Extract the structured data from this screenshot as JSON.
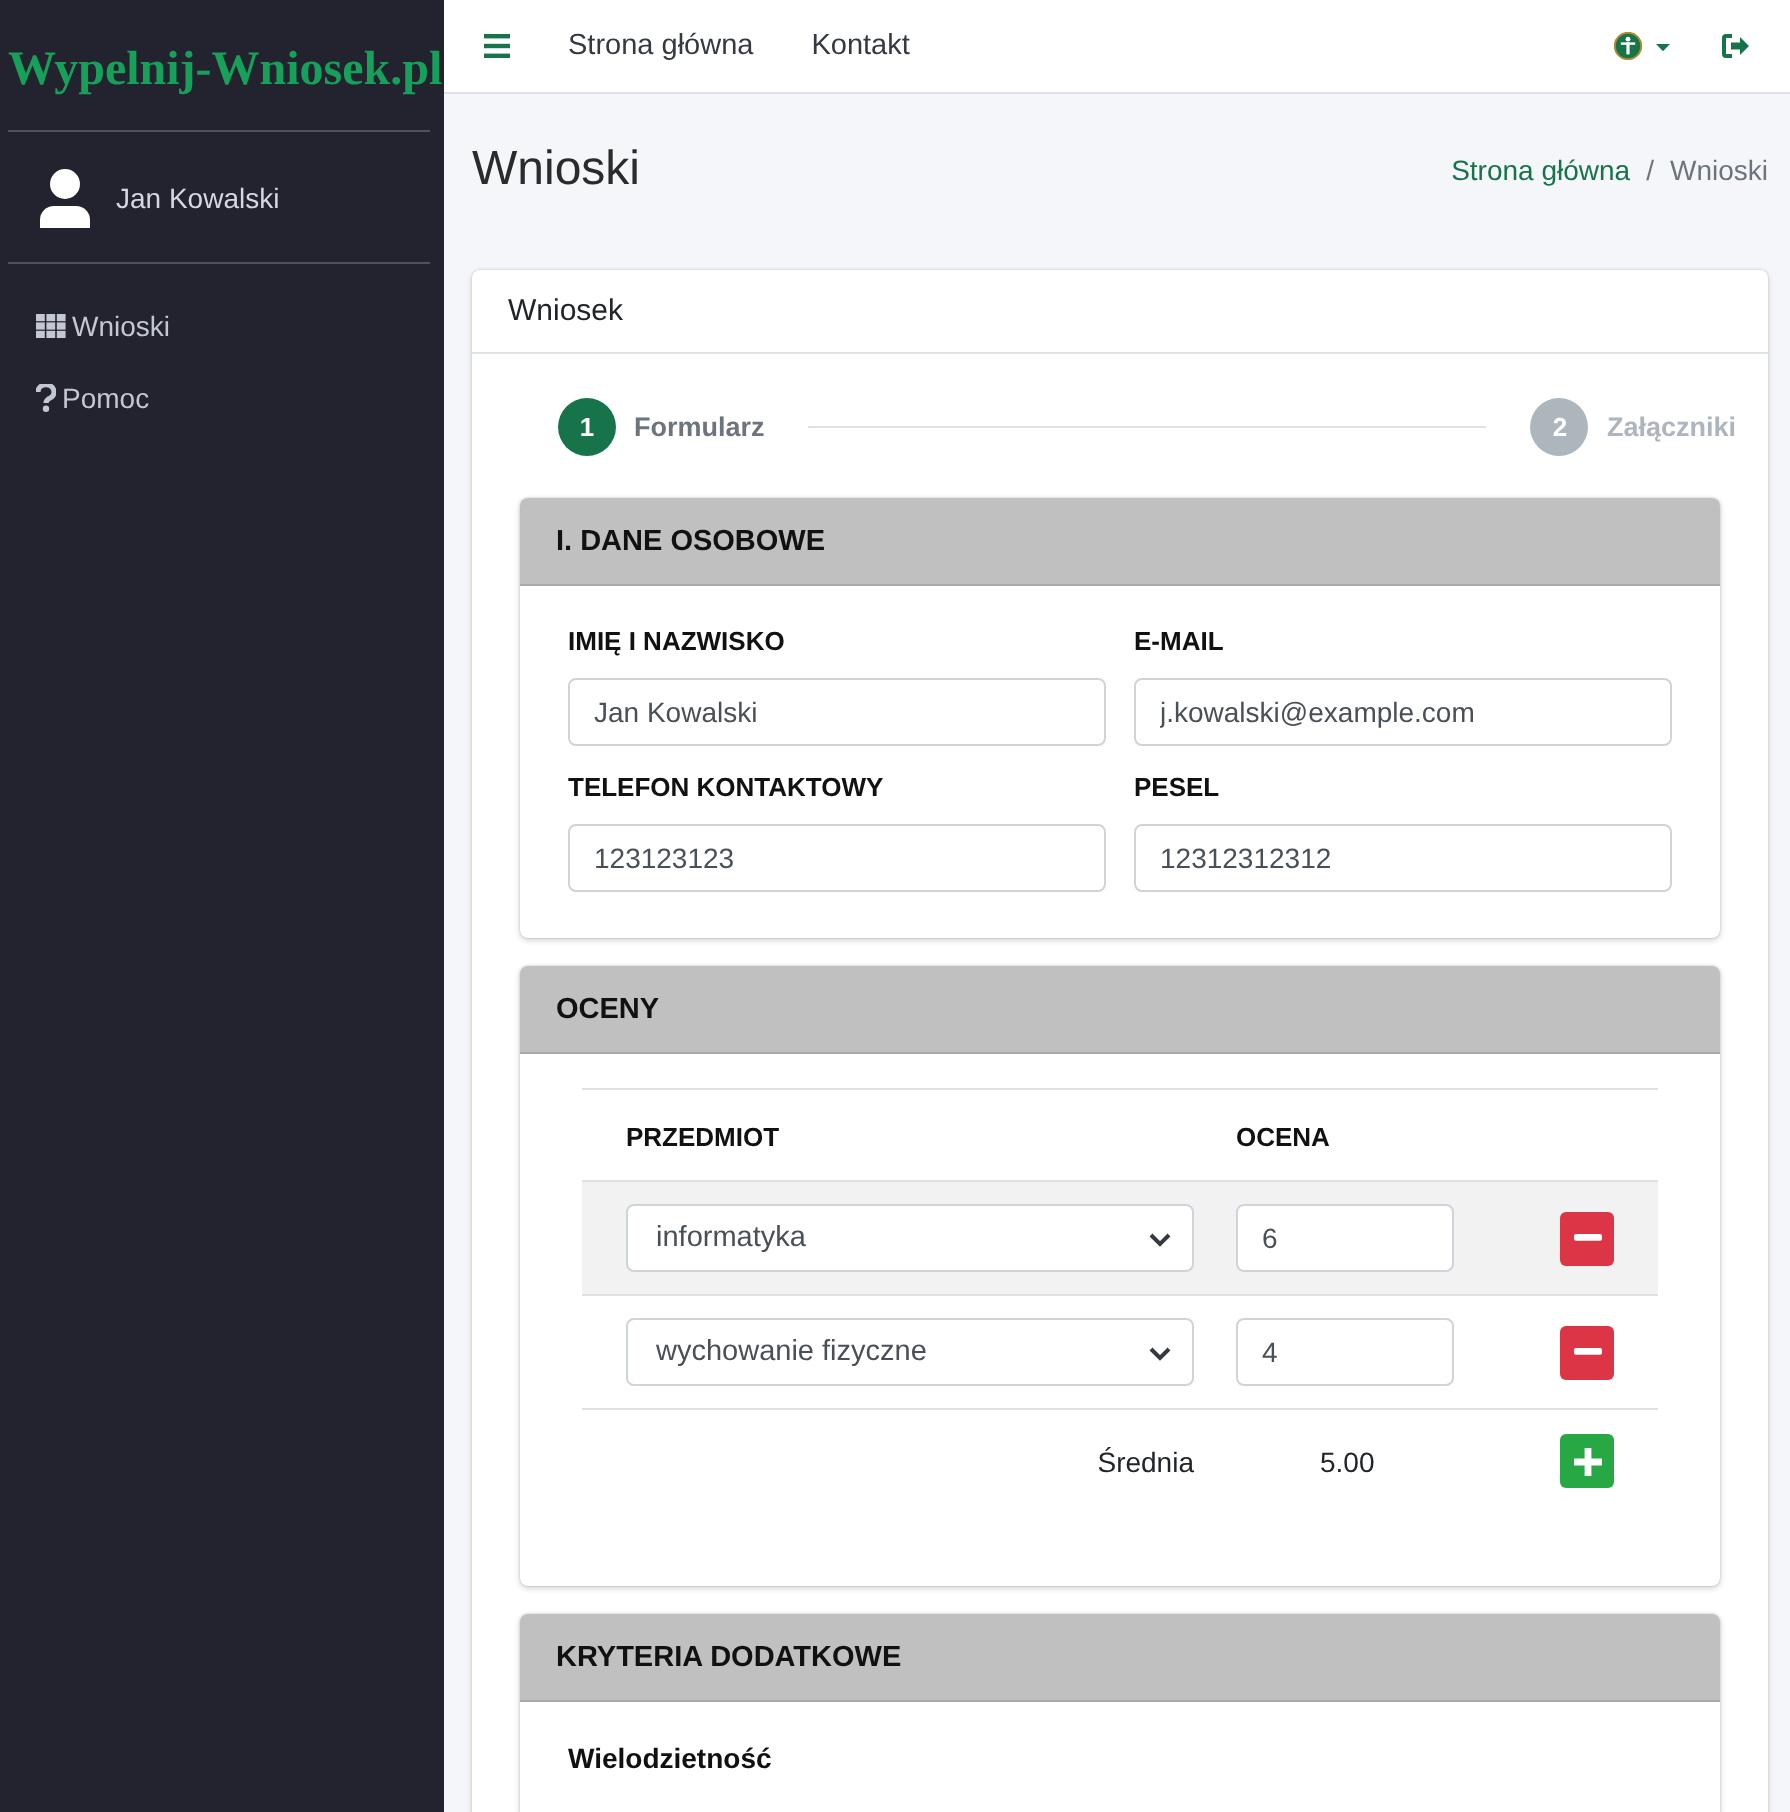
{
  "sidebar": {
    "brand": "Wypelnij-Wniosek.pl",
    "user": "Jan Kowalski",
    "items": [
      {
        "kind": "grid",
        "label": "Wnioski"
      },
      {
        "kind": "help",
        "label": "Pomoc"
      }
    ]
  },
  "topbar": {
    "links": [
      "Strona główna",
      "Kontakt"
    ]
  },
  "page": {
    "title": "Wnioski",
    "separator": "/",
    "breadcrumb": [
      {
        "label": "Strona główna",
        "link": true
      },
      {
        "label": "Wnioski",
        "link": false
      }
    ]
  },
  "card": {
    "title": "Wniosek",
    "steps": [
      {
        "number": "1",
        "label": "Formularz",
        "active": true
      },
      {
        "number": "2",
        "label": "Załączniki",
        "active": false
      }
    ]
  },
  "sections": [
    {
      "kind": "fields",
      "title": "I. DANE OSOBOWE",
      "fields": [
        {
          "label": "IMIĘ I NAZWISKO",
          "value": "Jan Kowalski"
        },
        {
          "label": "E-MAIL",
          "value": "j.kowalski@example.com"
        },
        {
          "label": "TELEFON KONTAKTOWY",
          "value": "123123123"
        },
        {
          "label": "PESEL",
          "value": "12312312312"
        }
      ]
    },
    {
      "kind": "grades",
      "title": "OCENY",
      "columns": [
        "PRZEDMIOT",
        "OCENA"
      ],
      "rows": [
        {
          "subject": "informatyka",
          "grade": "6",
          "highlighted": true
        },
        {
          "subject": "wychowanie fizyczne",
          "grade": "4",
          "highlighted": false
        }
      ],
      "average_label": "Średnia",
      "average": "5.00"
    },
    {
      "kind": "criteria",
      "title": "KRYTERIA DODATKOWE",
      "items": [
        "Wielodzietność"
      ]
    }
  ]
}
